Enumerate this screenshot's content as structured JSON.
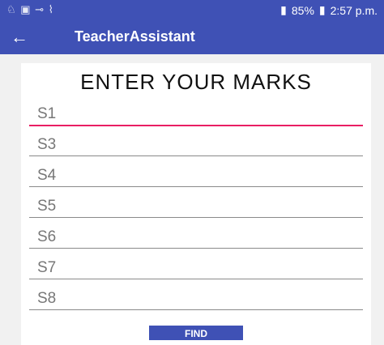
{
  "status_bar": {
    "left_icons": "♘ ▣ ⊸ ⌇",
    "battery": "85%",
    "time": "2:57 p.m."
  },
  "app_bar": {
    "back_icon": "←",
    "title": "TeacherAssistant"
  },
  "form": {
    "heading": "ENTER YOUR MARKS",
    "fields": [
      {
        "label": "S1",
        "active": true
      },
      {
        "label": "S3",
        "active": false
      },
      {
        "label": "S4",
        "active": false
      },
      {
        "label": "S5",
        "active": false
      },
      {
        "label": "S6",
        "active": false
      },
      {
        "label": "S7",
        "active": false
      },
      {
        "label": "S8",
        "active": false
      }
    ],
    "submit_label": "FIND"
  },
  "colors": {
    "primary": "#3f51b5",
    "accent": "#e91e63"
  }
}
